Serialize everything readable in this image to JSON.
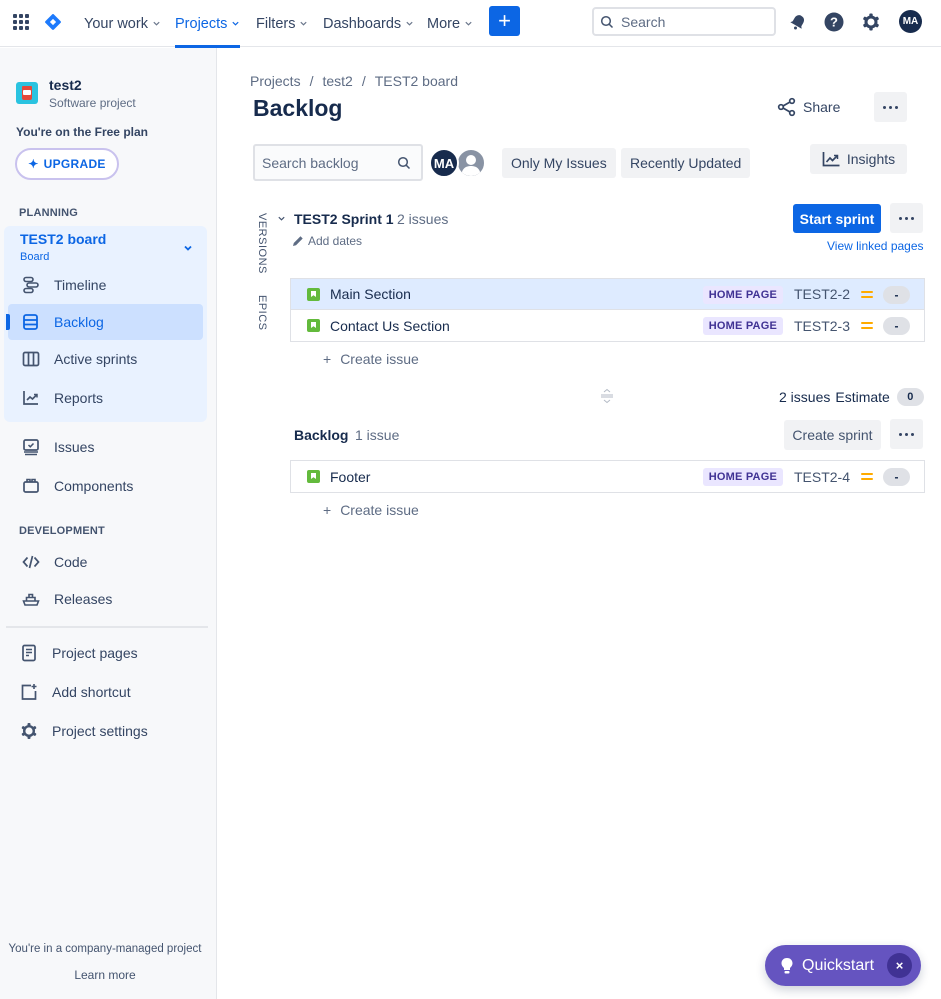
{
  "topnav": {
    "items": [
      {
        "label": "Your work",
        "active": false
      },
      {
        "label": "Projects",
        "active": true
      },
      {
        "label": "Filters",
        "active": false
      },
      {
        "label": "Dashboards",
        "active": false
      },
      {
        "label": "More",
        "active": false
      }
    ],
    "create_label": "+",
    "search_placeholder": "Search",
    "icons": [
      "app-switcher-icon",
      "jira-logo",
      "notifications-icon",
      "help-icon",
      "settings-icon"
    ],
    "avatar_initials": "MA",
    "accent_color": "#0c66e4"
  },
  "sidebar": {
    "project_name": "test2",
    "project_type": "Software project",
    "plan_text": "You're on the Free plan",
    "upgrade_label": "UPGRADE",
    "planning_label": "PLANNING",
    "board": {
      "title": "TEST2 board",
      "subtitle": "Board"
    },
    "planning_items": [
      {
        "label": "Timeline",
        "icon": "timeline-icon",
        "active": false
      },
      {
        "label": "Backlog",
        "icon": "backlog-icon",
        "active": true
      },
      {
        "label": "Active sprints",
        "icon": "active-sprints-icon",
        "active": false
      },
      {
        "label": "Reports",
        "icon": "reports-icon",
        "active": false
      }
    ],
    "other_items": [
      {
        "label": "Issues",
        "icon": "issues-icon"
      },
      {
        "label": "Components",
        "icon": "components-icon"
      }
    ],
    "development_label": "DEVELOPMENT",
    "development_items": [
      {
        "label": "Code",
        "icon": "code-icon"
      },
      {
        "label": "Releases",
        "icon": "releases-icon"
      }
    ],
    "bottom_items": [
      {
        "label": "Project pages",
        "icon": "project-pages-icon"
      },
      {
        "label": "Add shortcut",
        "icon": "add-shortcut-icon"
      },
      {
        "label": "Project settings",
        "icon": "project-settings-icon"
      }
    ],
    "footer_text": "You're in a company-managed project",
    "learn_more": "Learn more"
  },
  "main": {
    "breadcrumb": [
      "Projects",
      "test2",
      "TEST2 board"
    ],
    "breadcrumb_sep": "/",
    "title": "Backlog",
    "share_label": "Share",
    "search_placeholder": "Search backlog",
    "avatar_initials": "MA",
    "filters": [
      "Only My Issues",
      "Recently Updated"
    ],
    "insights_label": "Insights",
    "side_tabs": [
      "VERSIONS",
      "EPICS"
    ],
    "sprint": {
      "name": "TEST2 Sprint 1",
      "count": "2 issues",
      "add_dates": "Add dates",
      "start_label": "Start sprint",
      "view_linked": "View linked pages",
      "issues": [
        {
          "summary": "Main Section",
          "epic": "HOME PAGE",
          "key": "TEST2-2",
          "priority": "medium",
          "estimate": "-",
          "selected": true
        },
        {
          "summary": "Contact Us Section",
          "epic": "HOME PAGE",
          "key": "TEST2-3",
          "priority": "medium",
          "estimate": "-",
          "selected": false
        }
      ],
      "create_issue": "Create issue",
      "footer_count": "2 issues",
      "estimate_label": "Estimate",
      "estimate_value": "0"
    },
    "backlog": {
      "name": "Backlog",
      "count": "1 issue",
      "create_sprint_label": "Create sprint",
      "issues": [
        {
          "summary": "Footer",
          "epic": "HOME PAGE",
          "key": "TEST2-4",
          "priority": "medium",
          "estimate": "-",
          "selected": false
        }
      ],
      "create_issue": "Create issue"
    }
  },
  "quickstart": {
    "label": "Quickstart",
    "close": "×",
    "color": "#6554c0"
  }
}
